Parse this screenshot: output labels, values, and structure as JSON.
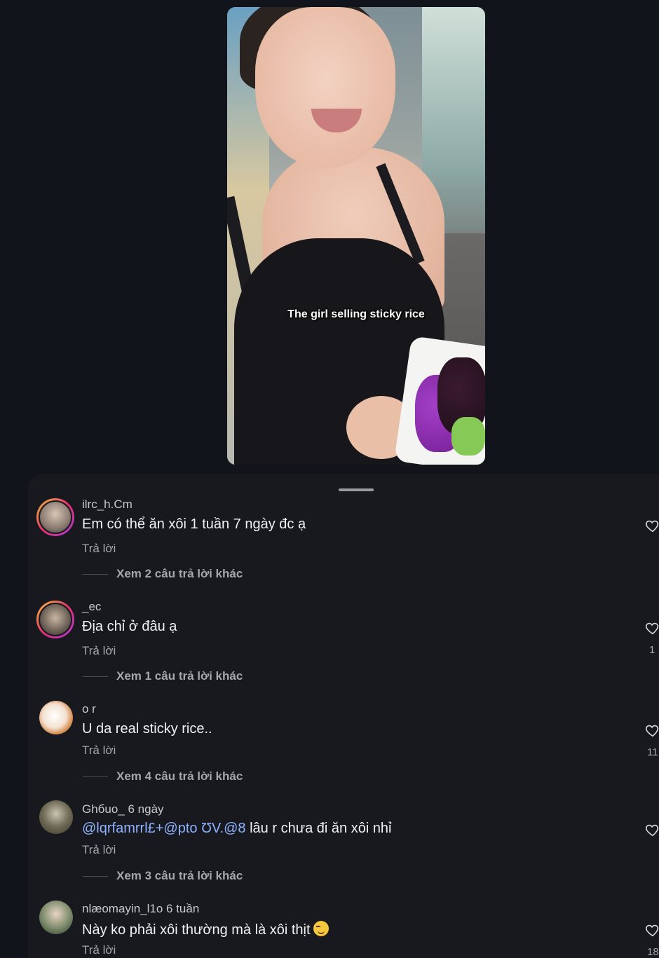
{
  "video": {
    "caption": "The girl selling sticky rice"
  },
  "comments": [
    {
      "username": "ilrc_h.Cm",
      "text": "Em có thể ăn xôi 1 tuần 7 ngày đc ạ",
      "reply_label": "Trả lời",
      "view_more": "Xem 2 câu trả lời khác",
      "likes": ""
    },
    {
      "username": "_ec",
      "text": "Địa chỉ ở đâu ạ",
      "reply_label": "Trả lời",
      "view_more": "Xem 1 câu trả lời khác",
      "likes": "1"
    },
    {
      "username": "o r",
      "text": "U da real sticky rice..",
      "reply_label": "Trả lời",
      "view_more": "Xem 4 câu trả lời khác",
      "likes": "11"
    },
    {
      "username": "Ghбuo_ 6 ngày",
      "mention": "@lqrfamrrl£+@pto",
      "mention2": "ƱV.@8",
      "text": "lâu r chưa đi ăn xôi nhỉ",
      "reply_label": "Trả lời",
      "view_more": "Xem 3 câu trả lời khác",
      "likes": ""
    },
    {
      "username": "nlæomayin_l1o 6 tuần",
      "text": "Này ko phải xôi thường mà là xôi thịt",
      "reply_label": "Trả lời",
      "likes": "18"
    }
  ],
  "colors": {
    "background": "#12141b",
    "sheet": "#17191f",
    "mention": "#8fb3ff",
    "story_ring": "#e6306a"
  }
}
